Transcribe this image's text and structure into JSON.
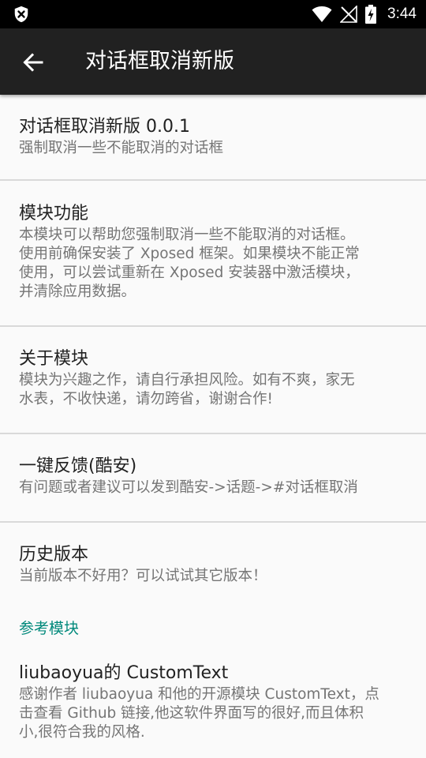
{
  "status_bar": {
    "time": "3:44",
    "icons": [
      "shield-icon",
      "wifi-icon",
      "no-signal-icon",
      "battery-charging-icon"
    ]
  },
  "toolbar": {
    "title": "对话框取消新版",
    "back_icon": "arrow-back-icon"
  },
  "preferences": [
    {
      "title": "对话框取消新版 0.0.1",
      "summary": [
        "强制取消一些不能取消的对话框"
      ]
    },
    {
      "title": "模块功能",
      "summary": [
        "本模块可以帮助您强制取消一些不能取消的对话框。",
        "使用前确保安装了 Xposed 框架。如果模块不能正常",
        "使用，可以尝试重新在 Xposed 安装器中激活模块，",
        "并清除应用数据。"
      ]
    },
    {
      "title": "关于模块",
      "summary": [
        "模块为兴趣之作，请自行承担风险。如有不爽，家无",
        "水表，不收快递，请勿跨省，谢谢合作!"
      ]
    },
    {
      "title": "一键反馈(酷安)",
      "summary": [
        "有问题或者建议可以发到酷安->话题->#对话框取消"
      ]
    },
    {
      "title": "历史版本",
      "summary": [
        "当前版本不好用？可以试试其它版本！"
      ]
    }
  ],
  "category": {
    "label": "参考模块",
    "items": [
      {
        "title": "liubaoyua的 CustomText",
        "summary": [
          "感谢作者 liubaoyua 和他的开源模块 CustomText，点",
          "击查看 Github 链接,他这软件界面写的很好,而且体积",
          "小,很符合我的风格."
        ]
      }
    ]
  },
  "colors": {
    "status_bar": "#000000",
    "toolbar": "#212121",
    "background": "#fafafa",
    "accent": "#00897b",
    "title_text": "#212121",
    "summary_text": "#757575",
    "divider": "#d9d9d9"
  }
}
